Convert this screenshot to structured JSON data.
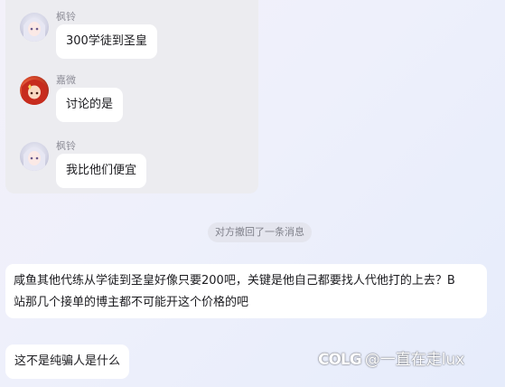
{
  "chat": {
    "messages": [
      {
        "sender": "枫铃",
        "text": "300学徒到圣皇",
        "avatar_icon": "anime-avatar-icon"
      },
      {
        "sender": "嘉微",
        "text": "讨论的是",
        "avatar_icon": "anime-avatar-icon"
      },
      {
        "sender": "枫铃",
        "text": "我比他们便宜",
        "avatar_icon": "anime-avatar-icon"
      }
    ],
    "recall_notice": "对方撤回了一条消息",
    "long_message": {
      "line1": "咸鱼其他代练从学徒到圣皇好像只要200吧，关键是他自己都要找人代他打的上去？B",
      "line2": "站那几个接单的博主都不可能开这个价格的吧"
    },
    "last_message": "这不是纯骗人是什么"
  },
  "watermark": {
    "logo": "COLG",
    "text": "@一直在走lux"
  },
  "colors": {
    "background_start": "#f3f1fa",
    "background_end": "#e6ecfb",
    "quote_block": "#ececf0",
    "bubble": "#ffffff"
  }
}
